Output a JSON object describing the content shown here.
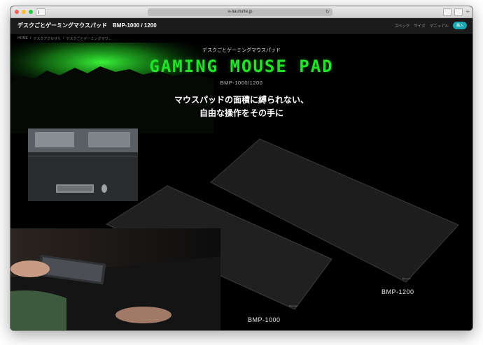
{
  "browser": {
    "url": "e-bauhutte.jp"
  },
  "site": {
    "title": "デスクごとゲーミングマウスパッド　BMP-1000 / 1200",
    "nav": [
      "スペック",
      "サイズ",
      "マニュアル"
    ],
    "buy_label": "購入"
  },
  "breadcrumb": [
    "HOME",
    "/",
    "デスクアクセサリ",
    "/",
    "デスクごとゲーミングマウ..."
  ],
  "hero": {
    "subtitle": "デスクごとゲーミングマウスパッド",
    "title": "GAMING MOUSE PAD",
    "model": "BMP-1000/1200",
    "tagline_1": "マウスパッドの面積に縛られない、",
    "tagline_2": "自由な操作をその手に",
    "label_large": "BMP-1200",
    "label_small": "BMP-1000"
  },
  "colors": {
    "accent_green": "#22e329",
    "buy_button": "#19a7b0",
    "pad": "#1e1e1e"
  }
}
